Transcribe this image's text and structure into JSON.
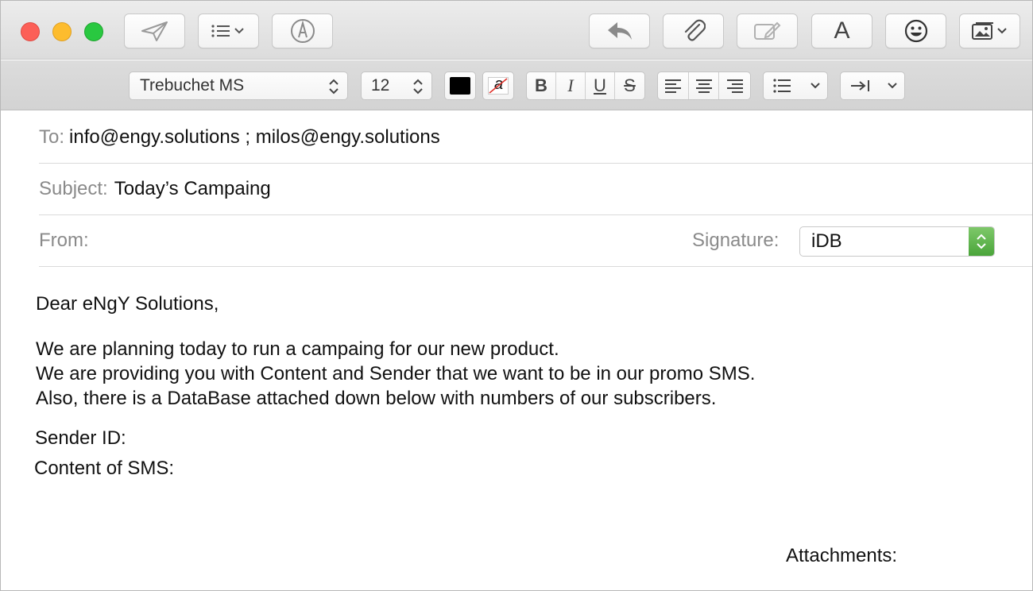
{
  "toolbar": {
    "send_icon": "paper-plane-icon",
    "header_fields_icon": "list-icon",
    "markup_icon": "pen-circle-icon",
    "reply_icon": "reply-arrow-icon",
    "attach_icon": "paperclip-icon",
    "markup2_icon": "pencil-box-icon",
    "fonts_icon": "A",
    "emoji_icon": "smiley-icon",
    "photo_icon": "photo-browser-icon"
  },
  "format": {
    "font_name": "Trebuchet MS",
    "font_size": "12",
    "text_color": "#000000",
    "bg_color_glyph": "a",
    "bold": "B",
    "italic": "I",
    "underline": "U",
    "strike": "S"
  },
  "header": {
    "to_label": "To:",
    "to_value": "info@engy.solutions ; milos@engy.solutions",
    "subject_label": "Subject:",
    "subject_value": "Today’s Campaing",
    "from_label": "From:",
    "signature_label": "Signature:",
    "signature_value": "iDB"
  },
  "message": {
    "greeting": "Dear eNgY Solutions,",
    "line1": "We are planning today to run a campaing for our new product.",
    "line2": "We are providing you with Content and Sender that we want to be in our promo SMS.",
    "line3": "Also, there is a DataBase attached down below with numbers of our subscribers.",
    "sender_id": "Sender ID:",
    "content_sms": "Content of SMS:",
    "attachments": "Attachments:"
  },
  "colors": {
    "accent_green": "#4aa53a",
    "close": "#fc5f57",
    "minimize": "#fdbc2e",
    "zoom": "#29c840"
  }
}
